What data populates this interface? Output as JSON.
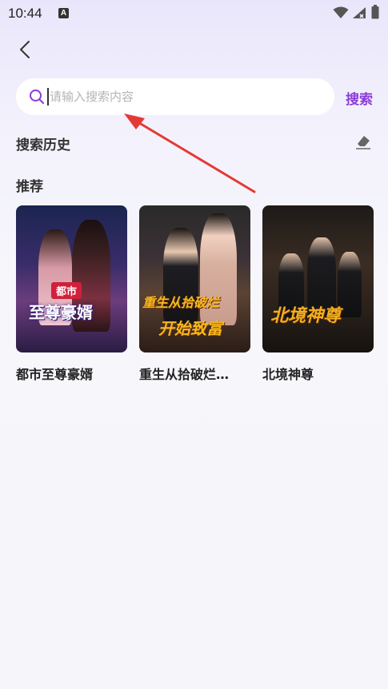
{
  "status_bar": {
    "time": "10:44",
    "notif_letter": "A"
  },
  "search": {
    "placeholder": "请输入搜索内容",
    "button_label": "搜索"
  },
  "history": {
    "title": "搜索历史"
  },
  "recommend": {
    "title": "推荐",
    "items": [
      {
        "title": "都市至尊豪婿",
        "poster_text_top": "都市",
        "poster_text_main": "至尊豪婿"
      },
      {
        "title": "重生从拾破烂…",
        "poster_text_top": "重生从拾破烂",
        "poster_text_main": "开始致富"
      },
      {
        "title": "北境神尊",
        "poster_text_main": "北境神尊"
      }
    ]
  },
  "colors": {
    "accent": "#8b3bd9",
    "arrow": "#e53935"
  }
}
